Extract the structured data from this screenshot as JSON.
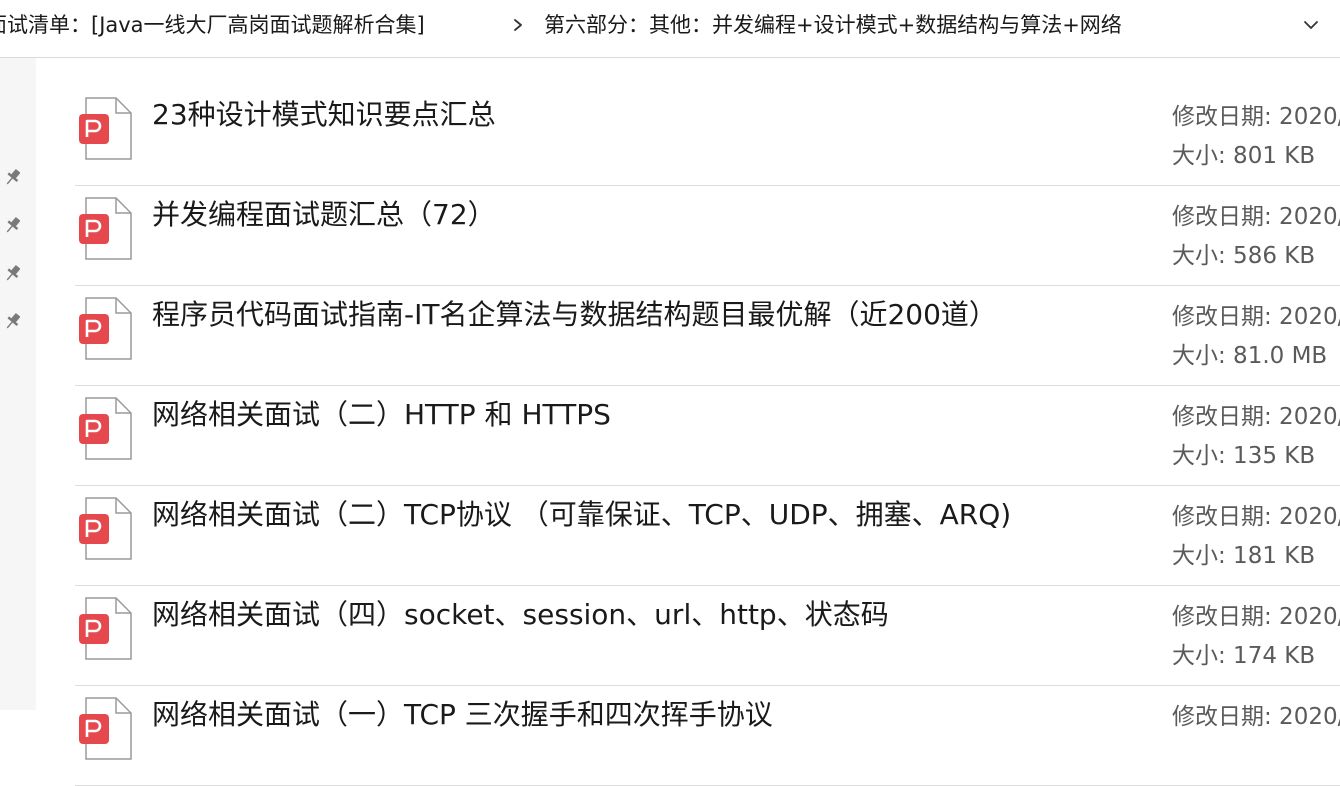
{
  "breadcrumb": {
    "parent": "面试清单：[Java一线大厂高岗面试题解析合集]",
    "separator_icon": "chevron-right-icon",
    "current": "第六部分：其他：并发编程+设计模式+数据结构与算法+网络",
    "expand_icon": "chevron-down-icon"
  },
  "quick_access": {
    "pins": [
      "pin-icon",
      "pin-icon",
      "pin-icon",
      "pin-icon"
    ]
  },
  "files": [
    {
      "name": "23种设计模式知识要点汇总",
      "date_label": "修改日期: 2020/",
      "size_label": "大小: 801 KB",
      "icon": "pdf-file-icon"
    },
    {
      "name": "并发编程面试题汇总（72）",
      "date_label": "修改日期: 2020/",
      "size_label": "大小: 586 KB",
      "icon": "pdf-file-icon"
    },
    {
      "name": "程序员代码面试指南-IT名企算法与数据结构题目最优解（近200道）",
      "date_label": "修改日期: 2020/",
      "size_label": "大小: 81.0 MB",
      "icon": "pdf-file-icon"
    },
    {
      "name": "网络相关面试（二）HTTP 和 HTTPS",
      "date_label": "修改日期: 2020/",
      "size_label": "大小: 135 KB",
      "icon": "pdf-file-icon"
    },
    {
      "name": "网络相关面试（二）TCP协议 （可靠保证、TCP、UDP、拥塞、ARQ)",
      "date_label": "修改日期: 2020/",
      "size_label": "大小: 181 KB",
      "icon": "pdf-file-icon"
    },
    {
      "name": "网络相关面试（四）socket、session、url、http、状态码",
      "date_label": "修改日期: 2020/",
      "size_label": "大小: 174 KB",
      "icon": "pdf-file-icon"
    },
    {
      "name": "网络相关面试（一）TCP 三次握手和四次挥手协议",
      "date_label": "修改日期: 2020/",
      "size_label": "",
      "icon": "pdf-file-icon"
    }
  ],
  "colors": {
    "pdf_badge": "#e5484d",
    "text": "#1a1a1a",
    "meta_text": "#5a5a5a",
    "divider": "#dcdcdc"
  }
}
